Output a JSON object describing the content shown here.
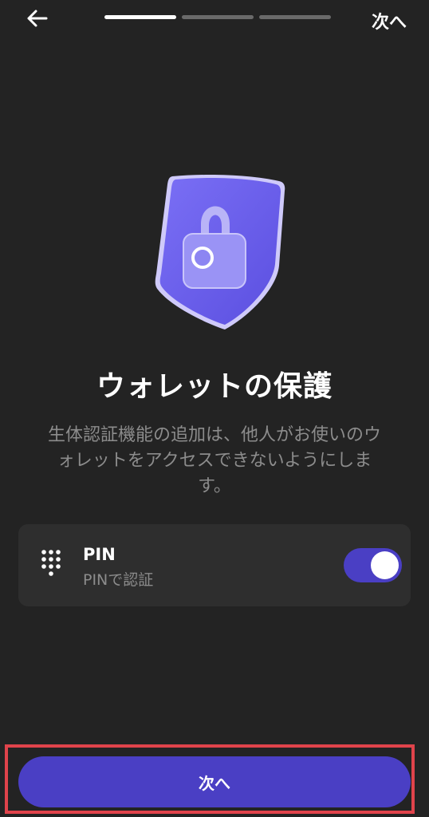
{
  "header": {
    "back_icon": "arrow-left-icon",
    "progress": {
      "total_steps": 3,
      "current_step": 1
    },
    "skip_label": "次へ"
  },
  "hero": {
    "icon": "shield-lock-icon",
    "colors": {
      "shield": "#6f63ee",
      "lock": "#9a93f5"
    }
  },
  "title": "ウォレットの保護",
  "description": "生体認証機能の追加は、他人がお使いのウォレットをアクセスできないようにします。",
  "options": [
    {
      "icon": "keypad-icon",
      "title": "PIN",
      "subtitle": "PINで認証",
      "enabled": true
    }
  ],
  "primary_button": {
    "label": "次へ"
  },
  "colors": {
    "background": "#232323",
    "card": "#2e2e2e",
    "accent": "#4a3fc4",
    "highlight": "#e0434b"
  }
}
